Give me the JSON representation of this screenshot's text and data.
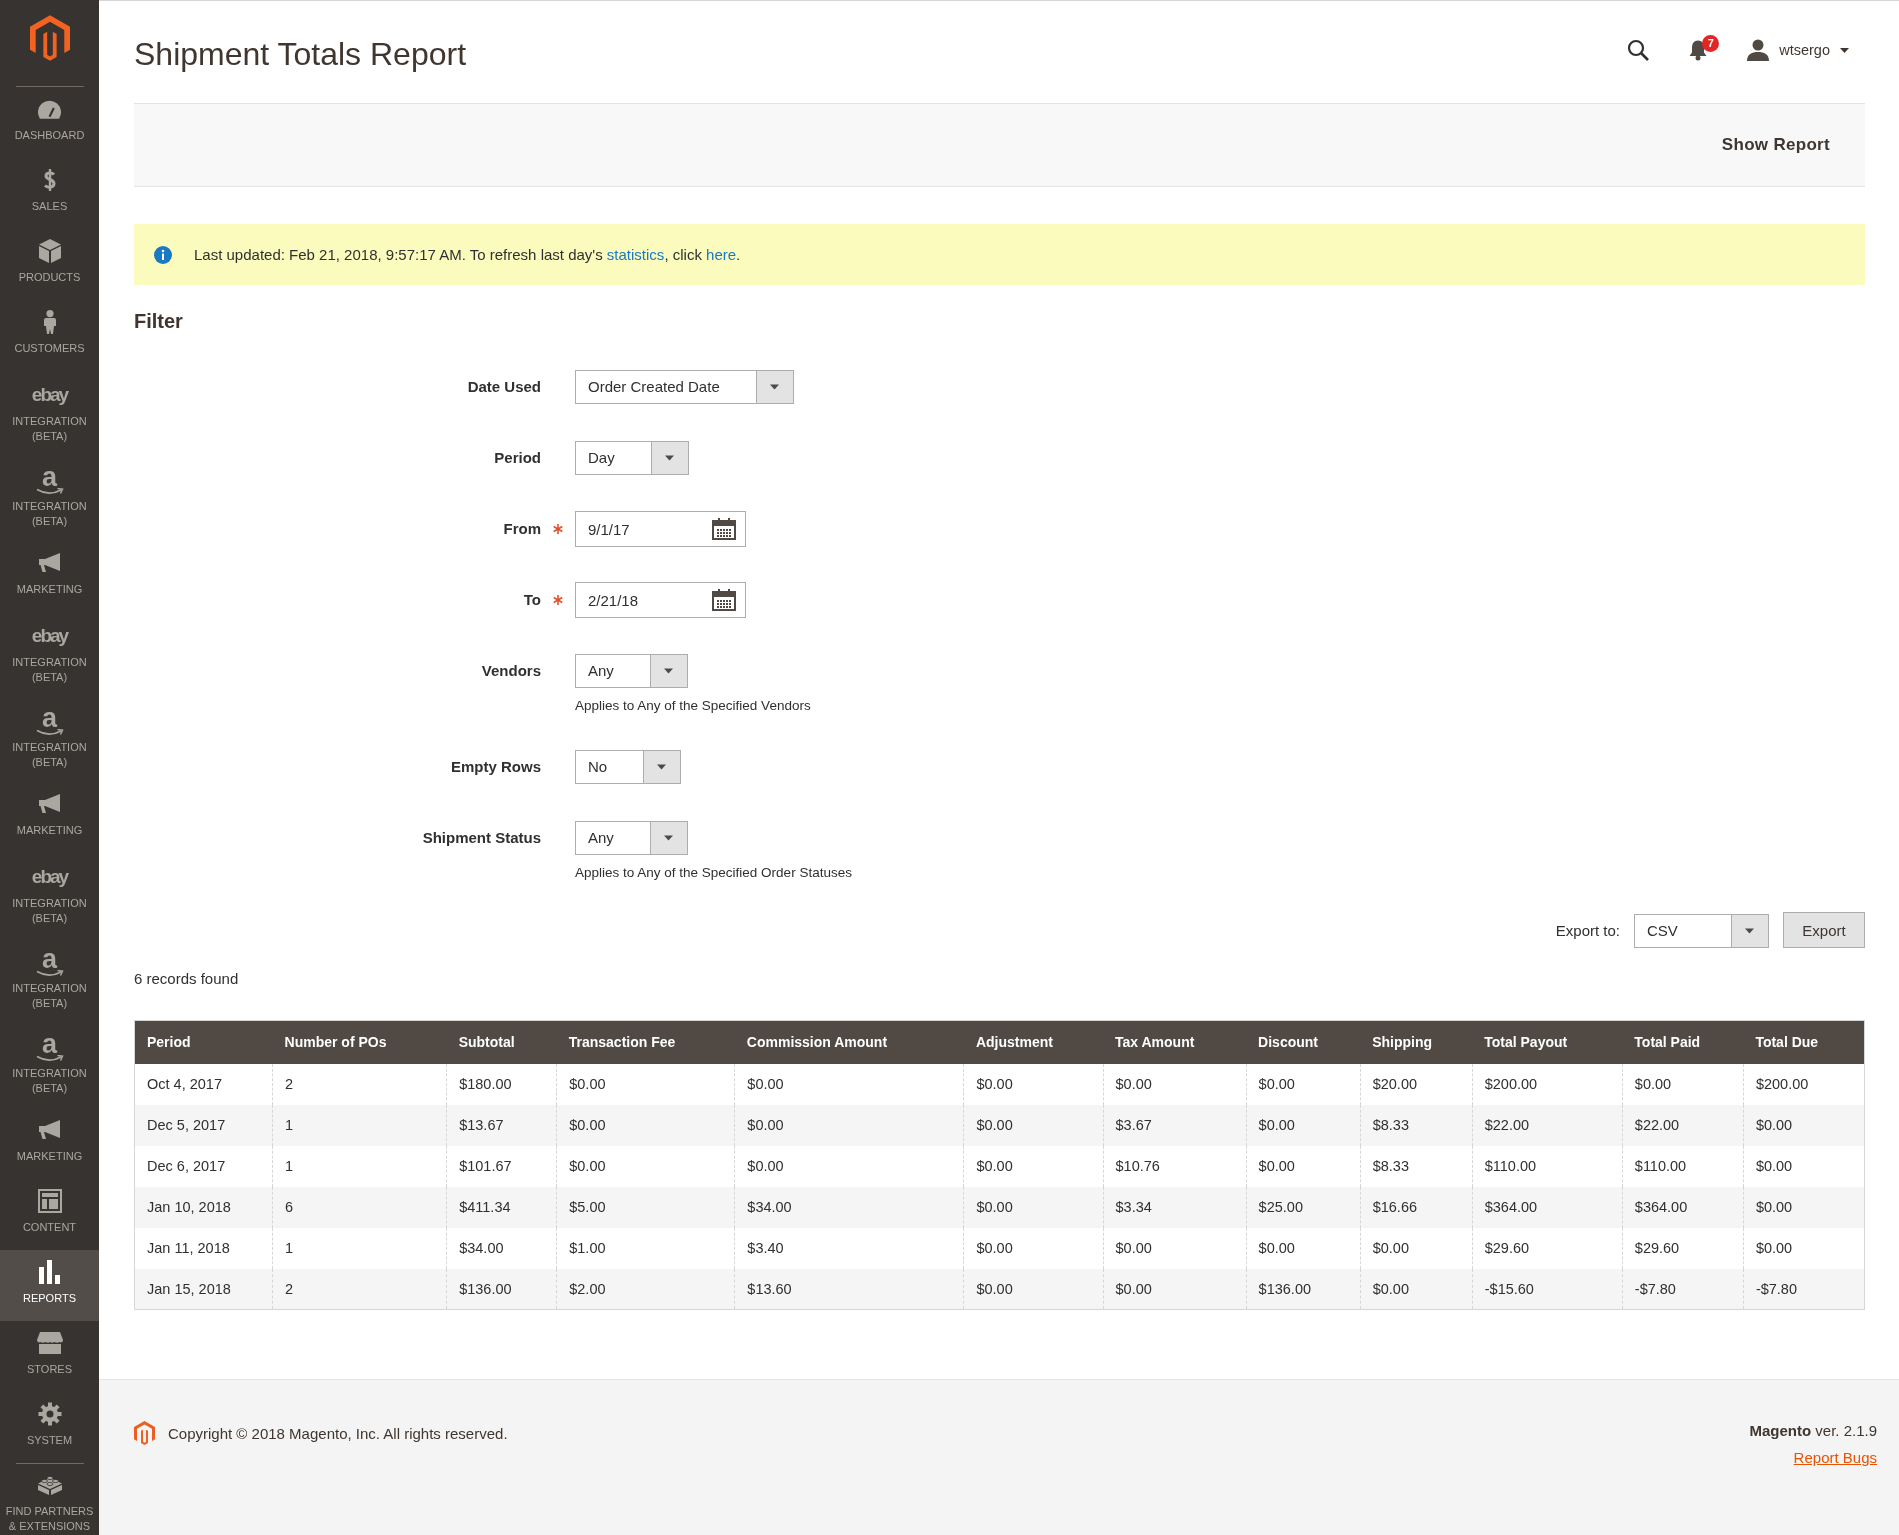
{
  "sidebar": {
    "items": [
      {
        "kind": "dashboard",
        "label": "DASHBOARD",
        "selected": false
      },
      {
        "kind": "sales",
        "label": "SALES",
        "selected": false
      },
      {
        "kind": "products",
        "label": "PRODUCTS",
        "selected": false
      },
      {
        "kind": "customers",
        "label": "CUSTOMERS",
        "selected": false
      },
      {
        "kind": "ebay",
        "logo_text": "ebay",
        "label": "INTEGRATION (BETA)",
        "selected": false
      },
      {
        "kind": "amazon",
        "logo_text": "a",
        "label": "INTEGRATION (BETA)",
        "selected": false
      },
      {
        "kind": "marketing",
        "label": "MARKETING",
        "selected": false
      },
      {
        "kind": "ebay",
        "logo_text": "ebay",
        "label": "INTEGRATION (BETA)",
        "selected": false
      },
      {
        "kind": "amazon",
        "logo_text": "a",
        "label": "INTEGRATION (BETA)",
        "selected": false
      },
      {
        "kind": "marketing",
        "label": "MARKETING",
        "selected": false
      },
      {
        "kind": "ebay",
        "logo_text": "ebay",
        "label": "INTEGRATION (BETA)",
        "selected": false
      },
      {
        "kind": "amazon",
        "logo_text": "a",
        "label": "INTEGRATION (BETA)",
        "selected": false
      },
      {
        "kind": "amazon",
        "logo_text": "a",
        "label": "INTEGRATION (BETA)",
        "selected": false
      },
      {
        "kind": "marketing",
        "label": "MARKETING",
        "selected": false
      },
      {
        "kind": "content",
        "label": "CONTENT",
        "selected": false
      },
      {
        "kind": "reports",
        "label": "REPORTS",
        "selected": true
      },
      {
        "kind": "stores",
        "label": "STORES",
        "selected": false
      },
      {
        "kind": "system",
        "label": "SYSTEM",
        "selected": false
      },
      {
        "kind": "partners",
        "label": "FIND PARTNERS & EXTENSIONS",
        "selected": false
      }
    ]
  },
  "header": {
    "title": "Shipment Totals Report",
    "notification_count": "7",
    "user": "wtsergo"
  },
  "page_actions": {
    "button": "Show Report"
  },
  "notice": {
    "segments": [
      {
        "kind": "text",
        "text": "Last updated: Feb 21, 2018, 9:57:17 AM. To refresh last day's "
      },
      {
        "kind": "link",
        "text": "statistics"
      },
      {
        "kind": "text",
        "text": ", click "
      },
      {
        "kind": "link",
        "text": "here"
      },
      {
        "kind": "text",
        "text": "."
      }
    ]
  },
  "filter": {
    "title": "Filter",
    "fields": [
      {
        "label": "Date Used",
        "kind": "select",
        "value": "Order Created Date",
        "required": false
      },
      {
        "label": "Period",
        "kind": "select",
        "value": "Day",
        "required": false
      },
      {
        "label": "From",
        "kind": "date",
        "value": "9/1/17",
        "required": true
      },
      {
        "label": "To",
        "kind": "date",
        "value": "2/21/18",
        "required": true
      },
      {
        "label": "Vendors",
        "kind": "select",
        "value": "Any",
        "note": "Applies to Any of the Specified Vendors",
        "required": false
      },
      {
        "label": "Empty Rows",
        "kind": "select",
        "value": "No",
        "required": false
      },
      {
        "label": "Shipment Status",
        "kind": "select",
        "value": "Any",
        "note": "Applies to Any of the Specified Order Statuses",
        "required": false
      }
    ]
  },
  "export": {
    "label": "Export to:",
    "format": "CSV",
    "button": "Export"
  },
  "records_found": "6 records found",
  "table": {
    "columns": [
      "Period",
      "Number of POs",
      "Subtotal",
      "Transaction Fee",
      "Commission Amount",
      "Adjustment",
      "Tax Amount",
      "Discount",
      "Shipping",
      "Total Payout",
      "Total Paid",
      "Total Due"
    ],
    "rows": [
      [
        "Oct 4, 2017",
        "2",
        "$180.00",
        "$0.00",
        "$0.00",
        "$0.00",
        "$0.00",
        "$0.00",
        "$20.00",
        "$200.00",
        "$0.00",
        "$200.00"
      ],
      [
        "Dec 5, 2017",
        "1",
        "$13.67",
        "$0.00",
        "$0.00",
        "$0.00",
        "$3.67",
        "$0.00",
        "$8.33",
        "$22.00",
        "$22.00",
        "$0.00"
      ],
      [
        "Dec 6, 2017",
        "1",
        "$101.67",
        "$0.00",
        "$0.00",
        "$0.00",
        "$10.76",
        "$0.00",
        "$8.33",
        "$110.00",
        "$110.00",
        "$0.00"
      ],
      [
        "Jan 10, 2018",
        "6",
        "$411.34",
        "$5.00",
        "$34.00",
        "$0.00",
        "$3.34",
        "$25.00",
        "$16.66",
        "$364.00",
        "$364.00",
        "$0.00"
      ],
      [
        "Jan 11, 2018",
        "1",
        "$34.00",
        "$1.00",
        "$3.40",
        "$0.00",
        "$0.00",
        "$0.00",
        "$0.00",
        "$29.60",
        "$29.60",
        "$0.00"
      ],
      [
        "Jan 15, 2018",
        "2",
        "$136.00",
        "$2.00",
        "$13.60",
        "$0.00",
        "$0.00",
        "$136.00",
        "$0.00",
        "-$15.60",
        "-$7.80",
        "-$7.80"
      ]
    ]
  },
  "footer": {
    "copyright": "Copyright © 2018 Magento, Inc. All rights reserved.",
    "version": "**Magento** ver. 2.1.9",
    "report_link": "Report Bugs"
  }
}
